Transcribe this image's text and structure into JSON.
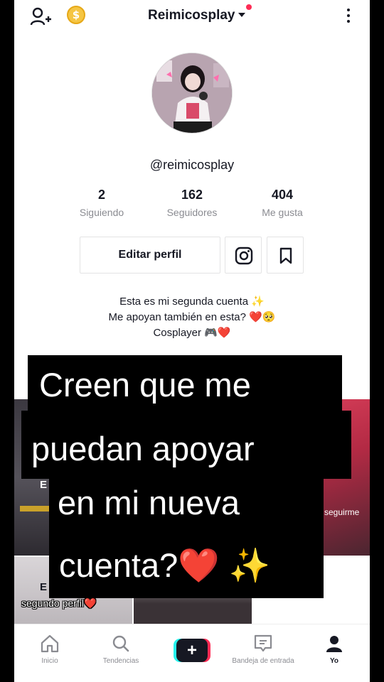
{
  "header": {
    "username": "Reimicosplay",
    "coin_symbol": "$"
  },
  "profile": {
    "handle": "@reimicosplay"
  },
  "stats": [
    {
      "value": "2",
      "label": "Siguiendo"
    },
    {
      "value": "162",
      "label": "Seguidores"
    },
    {
      "value": "404",
      "label": "Me gusta"
    }
  ],
  "actions": {
    "edit_label": "Editar perfil"
  },
  "bio": {
    "line1": "Esta es mi segunda cuenta ✨",
    "line2": "Me apoyan también en esta? ❤️🥺",
    "line3": "Cosplayer 🎮❤️"
  },
  "grid_text": {
    "tile1_fragment": "E",
    "tile3_text": "seguirme",
    "tile4_fragment": "E",
    "tile4_text": "segundo perfil❤️"
  },
  "caption": {
    "line1": "Creen que me",
    "line2": "puedan apoyar",
    "line3": "en mi nueva",
    "line4": "cuenta?❤️ ✨"
  },
  "nav": [
    {
      "label": "Inicio",
      "icon": "home-icon"
    },
    {
      "label": "Tendencias",
      "icon": "search-icon"
    },
    {
      "label": "",
      "icon": "plus-icon"
    },
    {
      "label": "Bandeja de entrada",
      "icon": "inbox-icon"
    },
    {
      "label": "Yo",
      "icon": "profile-icon"
    }
  ],
  "colors": {
    "accent_red": "#fe2c55",
    "accent_cyan": "#25f4ee",
    "text": "#161823",
    "muted": "#8a8b91"
  }
}
